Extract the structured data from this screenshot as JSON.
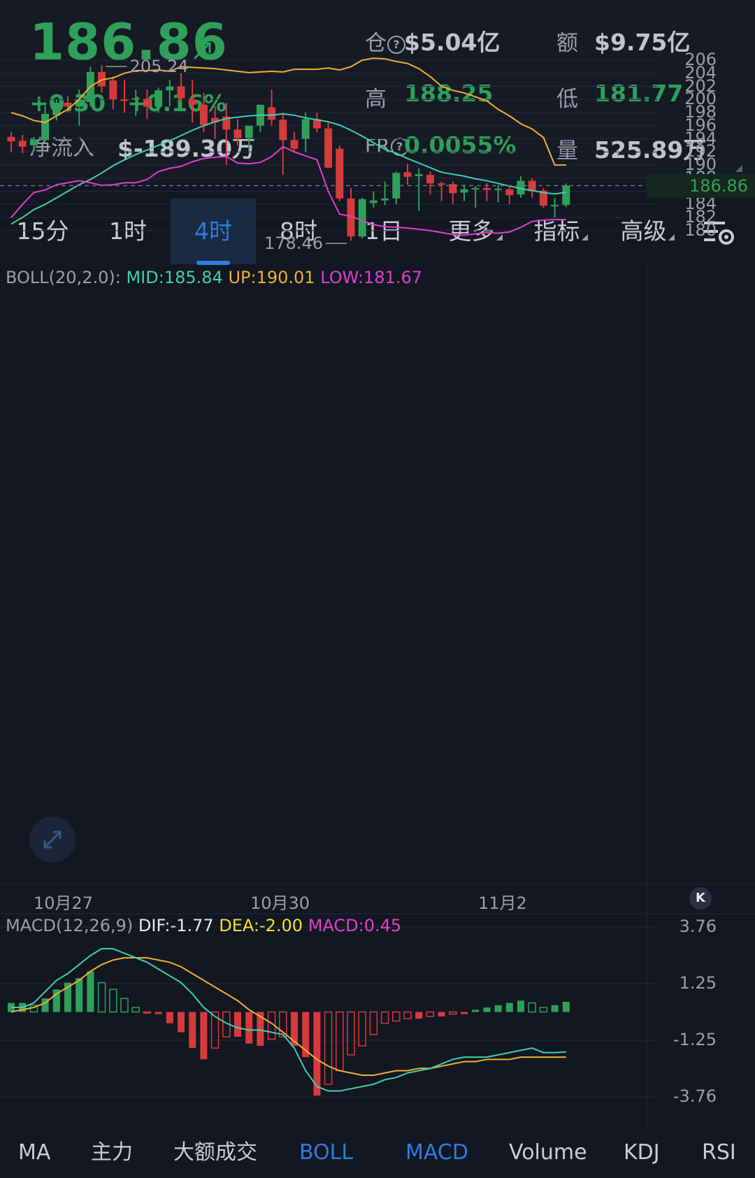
{
  "header": {
    "price": "186.86",
    "change": "+0.30",
    "change_pct": "+0.16%",
    "netflow_label": "净流入",
    "netflow_value": "$-189.30万",
    "oi_label": "仓",
    "oi_value": "$5.04亿",
    "amount_label": "额",
    "amount_value": "$9.75亿",
    "high_label": "高",
    "high_value": "188.25",
    "low_label": "低",
    "low_value": "181.77",
    "fr_label": "FR",
    "fr_value": "0.0055%",
    "volume_label": "量",
    "volume_value": "525.89万",
    "help_glyph": "?"
  },
  "tabs": [
    {
      "label": "15分",
      "active": false
    },
    {
      "label": "1时",
      "active": false
    },
    {
      "label": "4时",
      "active": true
    },
    {
      "label": "8时",
      "active": false
    },
    {
      "label": "1日",
      "active": false
    },
    {
      "label": "更多",
      "active": false
    },
    {
      "label": "指标",
      "active": false
    },
    {
      "label": "高级",
      "active": false
    }
  ],
  "boll_legend": {
    "name": "BOLL(20,2.0):",
    "mid": "MID:185.84",
    "up": "UP:190.01",
    "low": "LOW:181.67"
  },
  "macd_legend": {
    "name": "MACD(12,26,9)",
    "dif": "DIF:-1.77",
    "dea": "DEA:-2.00",
    "macd": "MACD:0.45"
  },
  "price_axis": [
    "206",
    "204",
    "202",
    "200",
    "198",
    "196",
    "194",
    "192",
    "190",
    "188",
    "186",
    "184",
    "182",
    "180"
  ],
  "macd_axis": [
    "3.76",
    "1.25",
    "-1.25",
    "-3.76"
  ],
  "x_axis": [
    "10月27",
    "10月30",
    "11月2"
  ],
  "current_price_tag": "186.86",
  "high_marker": "205.24",
  "low_marker": "178.46",
  "collapse_glyph": "K",
  "bottom_tabs": [
    {
      "label": "MA",
      "active": false
    },
    {
      "label": "主力",
      "active": false
    },
    {
      "label": "大额成交",
      "active": false
    },
    {
      "label": "BOLL",
      "active": true
    },
    {
      "label": "MACD",
      "active": true
    },
    {
      "label": "Volume",
      "active": false
    },
    {
      "label": "KDJ",
      "active": false
    },
    {
      "label": "RSI",
      "active": false
    }
  ],
  "colors": {
    "up": "#2ea05a",
    "down": "#d63a3a",
    "mid": "#3fd0b0",
    "upper": "#f0b030",
    "lower": "#e040c8",
    "dif": "#3fd0b0",
    "dea": "#f0b030",
    "accent": "#2f7ce0"
  },
  "chart_data": [
    {
      "type": "candlestick",
      "title": "",
      "ylim": [
        178,
        207
      ],
      "candles": [
        {
          "o": 194.3,
          "h": 195.0,
          "l": 192.0,
          "c": 193.6
        },
        {
          "o": 193.7,
          "h": 194.6,
          "l": 191.8,
          "c": 192.8
        },
        {
          "o": 193.0,
          "h": 194.3,
          "l": 192.1,
          "c": 193.9
        },
        {
          "o": 193.8,
          "h": 199.0,
          "l": 193.6,
          "c": 197.8
        },
        {
          "o": 197.6,
          "h": 200.0,
          "l": 196.8,
          "c": 199.5
        },
        {
          "o": 199.5,
          "h": 200.5,
          "l": 198.0,
          "c": 198.9
        },
        {
          "o": 198.9,
          "h": 201.5,
          "l": 196.0,
          "c": 200.0
        },
        {
          "o": 199.6,
          "h": 205.0,
          "l": 199.0,
          "c": 204.2
        },
        {
          "o": 204.2,
          "h": 205.24,
          "l": 201.0,
          "c": 202.0
        },
        {
          "o": 202.9,
          "h": 203.5,
          "l": 198.5,
          "c": 200.0
        },
        {
          "o": 200.0,
          "h": 203.0,
          "l": 198.0,
          "c": 199.9
        },
        {
          "o": 200.0,
          "h": 201.5,
          "l": 197.5,
          "c": 200.2
        },
        {
          "o": 200.1,
          "h": 201.5,
          "l": 197.0,
          "c": 198.9
        },
        {
          "o": 198.9,
          "h": 201.8,
          "l": 198.0,
          "c": 201.4
        },
        {
          "o": 201.4,
          "h": 203.0,
          "l": 199.0,
          "c": 202.0
        },
        {
          "o": 202.0,
          "h": 204.0,
          "l": 199.5,
          "c": 200.2
        },
        {
          "o": 200.0,
          "h": 203.0,
          "l": 196.5,
          "c": 199.2
        },
        {
          "o": 199.2,
          "h": 201.0,
          "l": 195.0,
          "c": 196.1
        },
        {
          "o": 197.2,
          "h": 199.0,
          "l": 194.0,
          "c": 196.5
        },
        {
          "o": 197.4,
          "h": 199.5,
          "l": 190.0,
          "c": 195.4
        },
        {
          "o": 195.4,
          "h": 197.0,
          "l": 193.0,
          "c": 194.1
        },
        {
          "o": 194.1,
          "h": 196.0,
          "l": 192.0,
          "c": 196.0
        },
        {
          "o": 196.0,
          "h": 199.0,
          "l": 195.0,
          "c": 199.2
        },
        {
          "o": 198.8,
          "h": 201.5,
          "l": 196.0,
          "c": 196.9
        },
        {
          "o": 196.9,
          "h": 198.0,
          "l": 188.5,
          "c": 193.8
        },
        {
          "o": 193.8,
          "h": 195.0,
          "l": 192.0,
          "c": 192.5
        },
        {
          "o": 194.0,
          "h": 198.0,
          "l": 192.0,
          "c": 197.0
        },
        {
          "o": 197.0,
          "h": 198.0,
          "l": 195.0,
          "c": 195.6
        },
        {
          "o": 195.6,
          "h": 196.5,
          "l": 189.5,
          "c": 189.6
        },
        {
          "o": 192.5,
          "h": 193.0,
          "l": 184.5,
          "c": 184.9
        },
        {
          "o": 184.9,
          "h": 186.5,
          "l": 178.46,
          "c": 179.1
        },
        {
          "o": 179.1,
          "h": 185.0,
          "l": 178.8,
          "c": 184.8
        },
        {
          "o": 184.2,
          "h": 186.0,
          "l": 183.5,
          "c": 184.6
        },
        {
          "o": 184.6,
          "h": 187.5,
          "l": 183.9,
          "c": 184.9
        },
        {
          "o": 184.9,
          "h": 189.0,
          "l": 184.0,
          "c": 188.8
        },
        {
          "o": 188.9,
          "h": 190.2,
          "l": 187.0,
          "c": 188.2
        },
        {
          "o": 188.3,
          "h": 189.5,
          "l": 183.0,
          "c": 188.6
        },
        {
          "o": 188.5,
          "h": 189.0,
          "l": 185.5,
          "c": 187.2
        },
        {
          "o": 187.2,
          "h": 187.5,
          "l": 184.5,
          "c": 187.0
        },
        {
          "o": 187.1,
          "h": 187.5,
          "l": 184.0,
          "c": 185.7
        },
        {
          "o": 185.8,
          "h": 187.0,
          "l": 184.5,
          "c": 186.3
        },
        {
          "o": 186.3,
          "h": 186.8,
          "l": 183.5,
          "c": 186.5
        },
        {
          "o": 186.5,
          "h": 187.2,
          "l": 184.5,
          "c": 186.2
        },
        {
          "o": 186.2,
          "h": 187.0,
          "l": 184.3,
          "c": 186.4
        },
        {
          "o": 186.3,
          "h": 186.8,
          "l": 184.0,
          "c": 185.4
        },
        {
          "o": 185.5,
          "h": 188.3,
          "l": 185.0,
          "c": 187.6
        },
        {
          "o": 187.6,
          "h": 188.0,
          "l": 185.0,
          "c": 186.0
        },
        {
          "o": 186.1,
          "h": 186.5,
          "l": 183.5,
          "c": 183.8
        },
        {
          "o": 183.8,
          "h": 185.0,
          "l": 182.0,
          "c": 183.9
        },
        {
          "o": 183.9,
          "h": 187.2,
          "l": 183.6,
          "c": 186.86
        }
      ],
      "boll_mid": [
        181.0,
        182.0,
        183.2,
        184.0,
        185.0,
        186.0,
        187.0,
        187.8,
        188.8,
        189.9,
        190.8,
        191.6,
        192.3,
        193.0,
        193.7,
        194.5,
        195.3,
        196.0,
        196.6,
        197.1,
        197.3,
        197.5,
        197.6,
        197.6,
        197.8,
        197.6,
        197.2,
        196.9,
        196.6,
        196.1,
        195.3,
        194.4,
        193.4,
        192.4,
        191.8,
        191.0,
        190.3,
        189.6,
        188.9,
        188.6,
        188.3,
        187.9,
        187.6,
        187.2,
        186.8,
        186.4,
        186.1,
        185.8,
        185.6,
        185.84
      ],
      "boll_up": [
        198.0,
        197.5,
        196.8,
        196.5,
        197.5,
        198.5,
        200.0,
        202.0,
        203.0,
        203.3,
        204.0,
        204.4,
        204.4,
        204.5,
        204.3,
        205.0,
        204.9,
        204.8,
        204.7,
        204.5,
        204.3,
        204.1,
        204.2,
        204.3,
        204.2,
        204.6,
        204.6,
        204.6,
        204.8,
        204.5,
        205.0,
        206.0,
        206.3,
        206.2,
        205.8,
        205.5,
        204.7,
        203.5,
        202.0,
        201.4,
        201.0,
        200.4,
        199.8,
        198.5,
        197.5,
        196.3,
        195.5,
        194.2,
        190.0,
        190.01
      ],
      "boll_low": [
        182.0,
        184.0,
        185.8,
        186.2,
        187.0,
        187.3,
        187.6,
        187.3,
        186.9,
        187.0,
        187.3,
        187.3,
        187.8,
        189.0,
        189.5,
        189.8,
        190.5,
        191.0,
        191.2,
        191.3,
        190.3,
        190.2,
        190.4,
        191.3,
        192.8,
        192.0,
        191.4,
        190.8,
        186.0,
        182.5,
        182.2,
        181.5,
        180.9,
        180.6,
        180.5,
        180.4,
        180.2,
        180.0,
        179.7,
        179.4,
        179.3,
        179.5,
        179.7,
        179.6,
        179.8,
        180.5,
        181.4,
        181.6,
        181.67,
        181.67
      ],
      "macd_dif": [
        0.2,
        0.2,
        0.4,
        0.9,
        1.4,
        1.7,
        2.1,
        2.5,
        2.8,
        2.8,
        2.6,
        2.4,
        2.2,
        1.9,
        1.6,
        1.3,
        0.8,
        0.2,
        -0.2,
        -0.5,
        -0.7,
        -0.8,
        -0.8,
        -0.9,
        -1.0,
        -1.6,
        -2.6,
        -3.3,
        -3.5,
        -3.5,
        -3.4,
        -3.3,
        -3.2,
        -3.0,
        -2.9,
        -2.7,
        -2.6,
        -2.5,
        -2.3,
        -2.1,
        -2.0,
        -2.0,
        -2.0,
        -1.9,
        -1.8,
        -1.7,
        -1.6,
        -1.8,
        -1.8,
        -1.77
      ],
      "macd_dea": [
        0.0,
        0.1,
        0.2,
        0.4,
        0.8,
        1.1,
        1.4,
        1.8,
        2.1,
        2.3,
        2.4,
        2.4,
        2.4,
        2.3,
        2.2,
        2.0,
        1.7,
        1.4,
        1.1,
        0.8,
        0.5,
        0.1,
        -0.2,
        -0.5,
        -0.9,
        -1.3,
        -1.7,
        -2.1,
        -2.4,
        -2.6,
        -2.7,
        -2.8,
        -2.8,
        -2.7,
        -2.6,
        -2.6,
        -2.5,
        -2.5,
        -2.4,
        -2.3,
        -2.2,
        -2.2,
        -2.1,
        -2.1,
        -2.1,
        -2.0,
        -2.0,
        -2.0,
        -2.0,
        -2.0
      ],
      "macd_hist": [
        0.4,
        0.4,
        0.3,
        0.6,
        1.0,
        1.3,
        1.5,
        1.8,
        1.3,
        1.0,
        0.6,
        0.2,
        -0.05,
        -0.1,
        -0.5,
        -0.9,
        -1.6,
        -2.1,
        -1.6,
        -1.1,
        -1.1,
        -1.4,
        -1.5,
        -1.2,
        -1.1,
        -1.5,
        -2.0,
        -3.7,
        -3.2,
        -2.6,
        -1.9,
        -1.5,
        -1.0,
        -0.5,
        -0.4,
        -0.3,
        -0.3,
        -0.2,
        -0.2,
        -0.1,
        -0.1,
        0.1,
        0.2,
        0.3,
        0.4,
        0.5,
        0.4,
        0.2,
        0.3,
        0.45
      ]
    }
  ]
}
